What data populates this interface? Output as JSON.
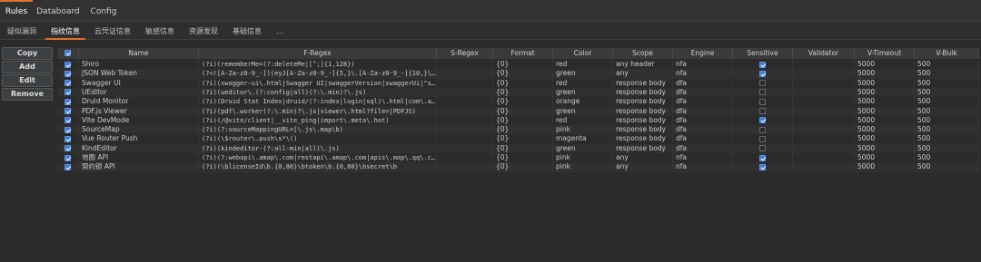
{
  "top_tabs": [
    {
      "label": "Rules",
      "active": true
    },
    {
      "label": "Databoard",
      "active": false
    },
    {
      "label": "Config",
      "active": false
    }
  ],
  "sub_tabs": [
    {
      "label": "疑似漏洞",
      "active": false
    },
    {
      "label": "指纹信息",
      "active": true
    },
    {
      "label": "云凭证信息",
      "active": false
    },
    {
      "label": "敏感信息",
      "active": false
    },
    {
      "label": "资源发现",
      "active": false
    },
    {
      "label": "基础信息",
      "active": false
    },
    {
      "label": "...",
      "active": false
    }
  ],
  "buttons": {
    "copy": "Copy",
    "add": "Add",
    "edit": "Edit",
    "remove": "Remove"
  },
  "table": {
    "header_all_checked": true,
    "columns": [
      "Name",
      "F-Regex",
      "S-Regex",
      "Format",
      "Color",
      "Scope",
      "Engine",
      "Sensitive",
      "Validator",
      "V-Timeout",
      "V-Bulk"
    ],
    "rows": [
      {
        "loaded": true,
        "name": "Shiro",
        "fregex": "(?i)(rememberMe=(?:deleteMe|[^;]{1,128})",
        "sregex": "",
        "format": "{0}",
        "color": "red",
        "scope": "any header",
        "engine": "nfa",
        "sensitive": true,
        "validator": "",
        "vtimeout": "5000",
        "vbulk": "500"
      },
      {
        "loaded": true,
        "name": "JSON Web Token",
        "fregex": "(?<![A-Za-z0-9_-])(eyJ[A-Za-z0-9_-]{5,}\\.[A-Za-z0-9_-]{10,}\\.[A-Za-z...",
        "sregex": "",
        "format": "{0}",
        "color": "green",
        "scope": "any",
        "engine": "nfa",
        "sensitive": true,
        "validator": "",
        "vtimeout": "5000",
        "vbulk": "500"
      },
      {
        "loaded": true,
        "name": "Swagger UI",
        "fregex": "(?i)(swagger-ui\\.html|Swagger UI|swaggerVersion|swaggerUi|\"s...",
        "sregex": "",
        "format": "{0}",
        "color": "red",
        "scope": "response body",
        "engine": "dfa",
        "sensitive": false,
        "validator": "",
        "vtimeout": "5000",
        "vbulk": "500"
      },
      {
        "loaded": true,
        "name": "UEditor",
        "fregex": "(?i)(ueditor\\.(?:config|all)(?:\\.min)?\\.js)",
        "sregex": "",
        "format": "{0}",
        "color": "green",
        "scope": "response body",
        "engine": "dfa",
        "sensitive": false,
        "validator": "",
        "vtimeout": "5000",
        "vbulk": "500"
      },
      {
        "loaded": true,
        "name": "Druid Monitor",
        "fregex": "(?i)(Druid Stat Index|druid/(?:index|login|sql)\\.html|com\\.alibab...",
        "sregex": "",
        "format": "{0}",
        "color": "orange",
        "scope": "response body",
        "engine": "dfa",
        "sensitive": false,
        "validator": "",
        "vtimeout": "5000",
        "vbulk": "500"
      },
      {
        "loaded": true,
        "name": "PDF.js Viewer",
        "fregex": "(?i)(pdf\\.worker(?:\\.min)?\\.js|viewer\\.html?file=|PDFJS)",
        "sregex": "",
        "format": "{0}",
        "color": "green",
        "scope": "response body",
        "engine": "dfa",
        "sensitive": false,
        "validator": "",
        "vtimeout": "5000",
        "vbulk": "500"
      },
      {
        "loaded": true,
        "name": "Vite DevMode",
        "fregex": "(?i)(/@vite/client|__vite_ping|import\\.meta\\.hot)",
        "sregex": "",
        "format": "{0}",
        "color": "red",
        "scope": "response body",
        "engine": "dfa",
        "sensitive": true,
        "validator": "",
        "vtimeout": "5000",
        "vbulk": "500"
      },
      {
        "loaded": true,
        "name": "SourceMap",
        "fregex": "(?i)(?:sourceMappingURL=[\\.js\\.map\\b)",
        "sregex": "",
        "format": "{0}",
        "color": "pink",
        "scope": "response body",
        "engine": "dfa",
        "sensitive": false,
        "validator": "",
        "vtimeout": "5000",
        "vbulk": "500"
      },
      {
        "loaded": true,
        "name": "Vue Router Push",
        "fregex": "(?i)(\\$router\\.push\\s*\\()",
        "sregex": "",
        "format": "{0}",
        "color": "magenta",
        "scope": "response body",
        "engine": "dfa",
        "sensitive": false,
        "validator": "",
        "vtimeout": "5000",
        "vbulk": "500"
      },
      {
        "loaded": true,
        "name": "KindEditor",
        "fregex": "(?i)(kindeditor-(?:all-min|all)\\.js)",
        "sregex": "",
        "format": "{0}",
        "color": "green",
        "scope": "response body",
        "engine": "dfa",
        "sensitive": false,
        "validator": "",
        "vtimeout": "5000",
        "vbulk": "500"
      },
      {
        "loaded": true,
        "name": "地图 API",
        "fregex": "(?i)(?:webapi\\.amap\\.com|restapi\\.amap\\.com|apis\\.map\\.qq\\.co...",
        "sregex": "",
        "format": "{0}",
        "color": "pink",
        "scope": "any",
        "engine": "nfa",
        "sensitive": true,
        "validator": "",
        "vtimeout": "5000",
        "vbulk": "500"
      },
      {
        "loaded": true,
        "name": "契约锁 API",
        "fregex": "(?i)(\\blicenseId\\b.{0,80}\\btoken\\b.{0,80}\\bsecret\\b",
        "sregex": "",
        "format": "{0}",
        "color": "pink",
        "scope": "any",
        "engine": "nfa",
        "sensitive": true,
        "validator": "",
        "vtimeout": "5000",
        "vbulk": "500"
      }
    ]
  }
}
